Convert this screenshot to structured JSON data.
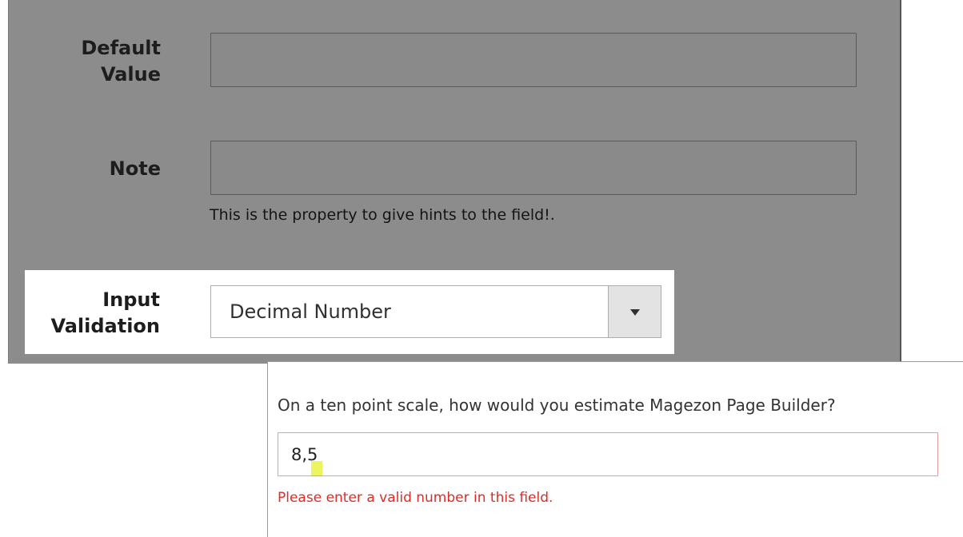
{
  "settings": {
    "default_value": {
      "label_line1": "Default",
      "label_line2": "Value",
      "value": ""
    },
    "note": {
      "label": "Note",
      "value": "",
      "hint": "This is the property to give hints to the field!."
    },
    "input_validation": {
      "label_line1": "Input",
      "label_line2": "Validation",
      "selected": "Decimal Number"
    }
  },
  "preview": {
    "question": "On a ten point scale, how would you estimate Magezon Page Builder?",
    "answer": "8,5",
    "error": "Please enter a valid number in this field."
  },
  "colors": {
    "overlay": "#8c8c8c",
    "error": "#e02b27",
    "cursor_highlight": "#e6f028"
  }
}
